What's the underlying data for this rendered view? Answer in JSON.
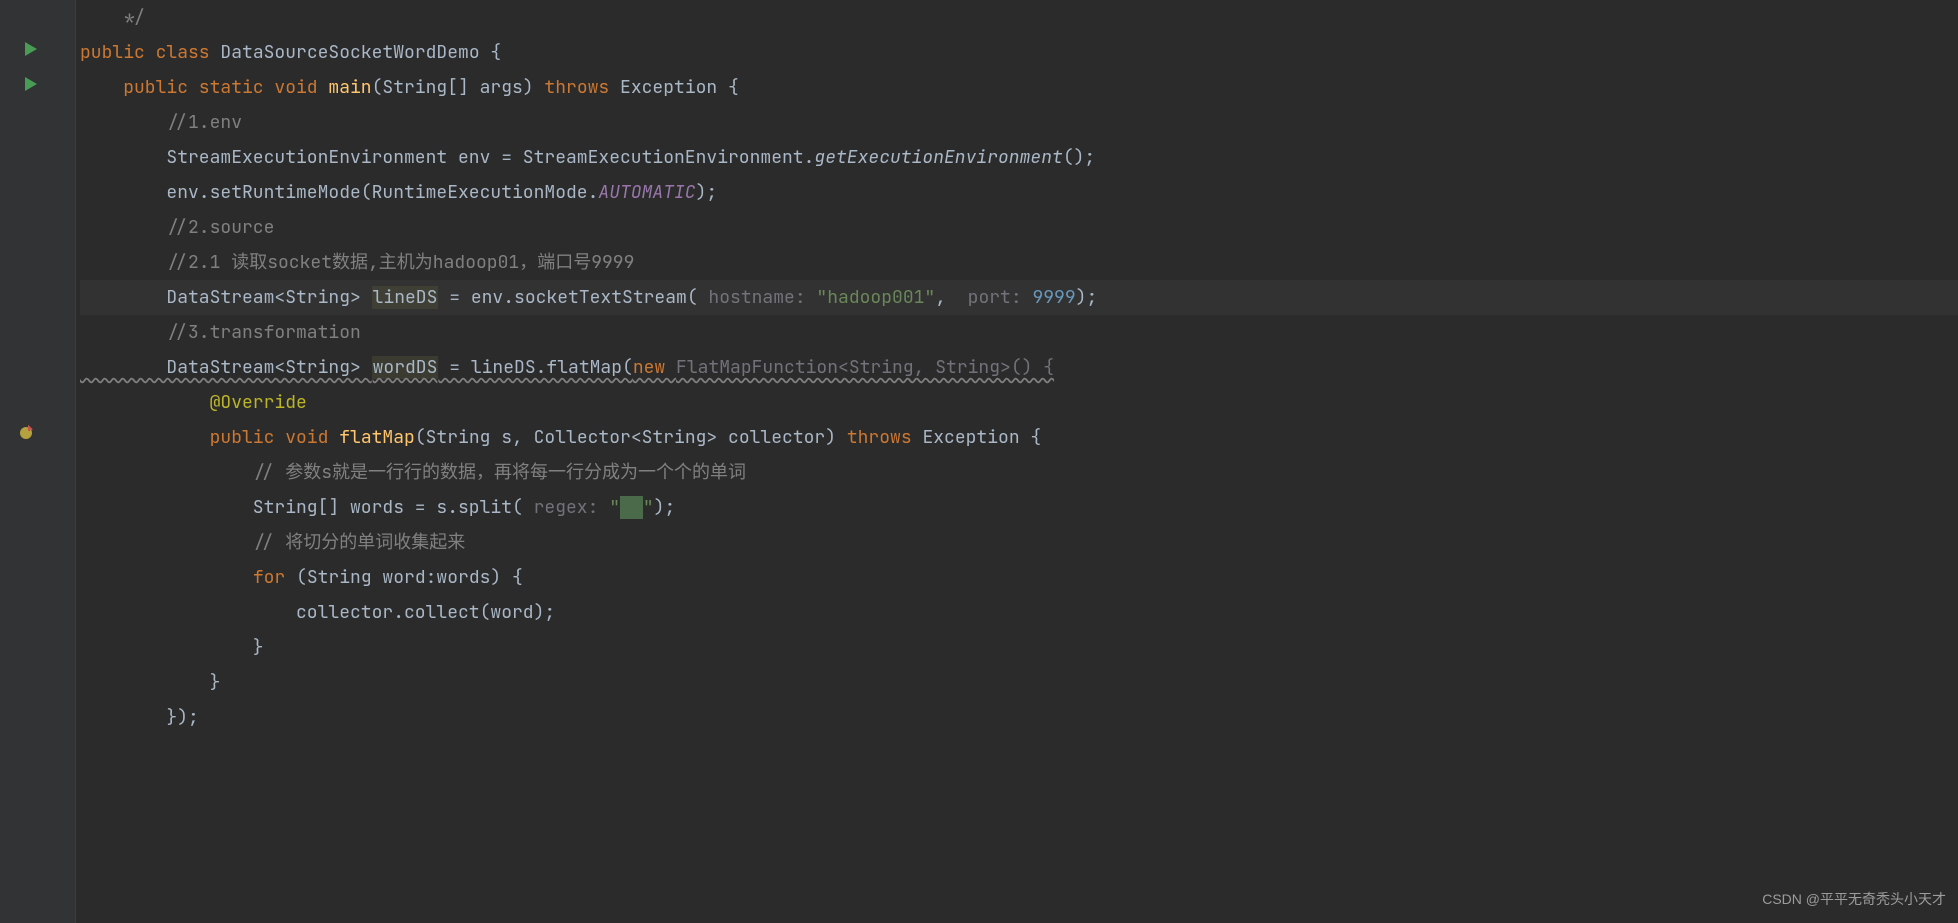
{
  "watermark": "CSDN @平平无奇秃头小天才",
  "gutter": {
    "warn_color": "#b5a23e"
  },
  "code": {
    "l0": "    */",
    "l1_kw_public": "public ",
    "l1_kw_class": "class ",
    "l1_cls": "DataSourceSocketWordDemo ",
    "l1_brace": "{",
    "l2_indent": "    ",
    "l2_kw": "public static void ",
    "l2_name": "main",
    "l2_sig": "(String[] args) ",
    "l2_throws": "throws ",
    "l2_exc": "Exception {",
    "l3": "        //1.env",
    "l4_a": "        StreamExecutionEnvironment env = StreamExecutionEnvironment.",
    "l4_b": "getExecutionEnvironment",
    "l4_c": "();",
    "l5_a": "        env.setRuntimeMode(RuntimeExecutionMode.",
    "l5_b": "AUTOMATIC",
    "l5_c": ");",
    "l6": "        //2.source",
    "l7": "        //2.1 读取socket数据,主机为hadoop01，端口号9999",
    "l8_a": "        DataStream<String> ",
    "l8_var": "lineDS",
    "l8_b": " = env.socketTextStream( ",
    "l8_p1": "hostname: ",
    "l8_s1": "\"hadoop001\"",
    "l8_comma": ",  ",
    "l8_p2": "port: ",
    "l8_n": "9999",
    "l8_end": ");",
    "l9": "        //3.transformation",
    "l10_a": "        DataStream<String> ",
    "l10_var": "wordDS",
    "l10_b": " = lineDS.flatMap(",
    "l10_new": "new ",
    "l10_c": "FlatMapFunction<String, String>() {",
    "l11_a": "            ",
    "l11_annot": "@Override",
    "l12_a": "            ",
    "l12_kw": "public void ",
    "l12_name": "flatMap",
    "l12_sig": "(String s, Collector<String> collector) ",
    "l12_throws": "throws ",
    "l12_exc": "Exception {",
    "l13": "                // 参数s就是一行行的数据，再将每一行分成为一个个的单词",
    "l14_a": "                String[] words = s.split( ",
    "l14_p": "regex: ",
    "l14_q1": "\"",
    "l14_space": " ",
    "l14_q2": "\"",
    "l14_end": ");",
    "l15": "                // 将切分的单词收集起来",
    "l16_a": "                ",
    "l16_for": "for ",
    "l16_b": "(String word:words) {",
    "l17": "                    collector.collect(word);",
    "l18": "                }",
    "l19": "            }",
    "l20": "        });"
  }
}
